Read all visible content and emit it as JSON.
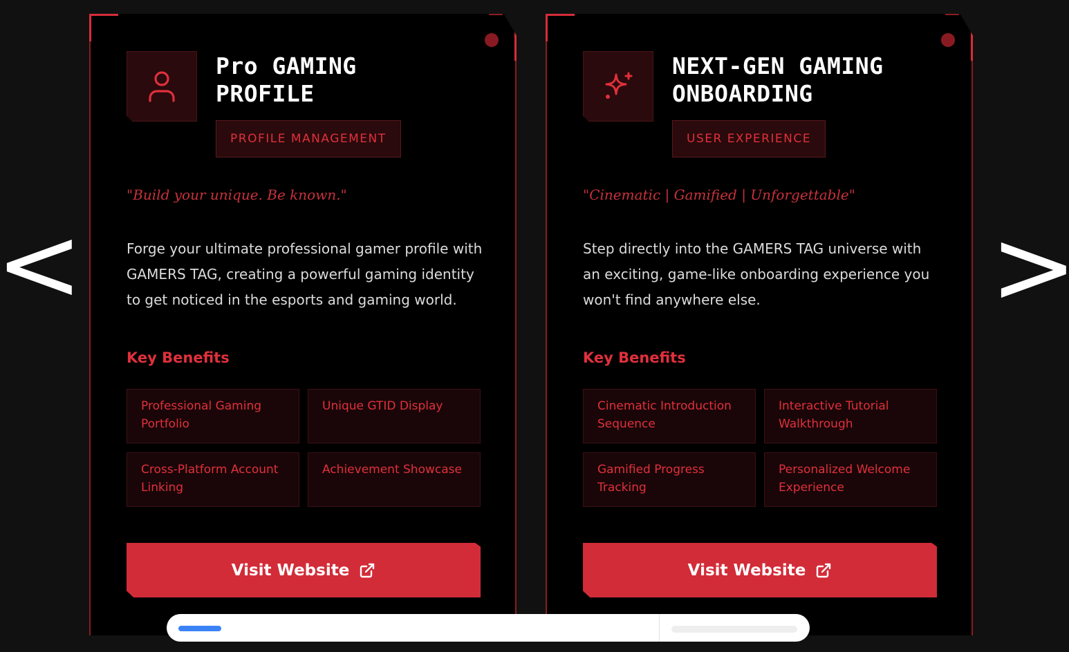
{
  "nav": {
    "prev_label": "<",
    "next_label": ">"
  },
  "cards": [
    {
      "icon": "user-icon",
      "title_line1": "Pro GAMING",
      "title_line2": "PROFILE",
      "tag": "PROFILE MANAGEMENT",
      "quote": "\"Build your unique. Be known.\"",
      "description": "Forge your ultimate professional gamer profile with GAMERS TAG, creating a powerful gaming identity to get noticed in the esports and gaming world.",
      "key_benefits_label": "Key Benefits",
      "benefits": [
        "Professional Gaming Portfolio",
        "Unique GTID Display",
        "Cross-Platform Account Linking",
        "Achievement Showcase"
      ],
      "button_label": "Visit Website",
      "button_icon": "external-link-icon"
    },
    {
      "icon": "sparkles-icon",
      "title_line1": "NEXT-GEN GAMING",
      "title_line2": "ONBOARDING",
      "tag": "USER EXPERIENCE",
      "quote": "\"Cinematic | Gamified | Unforgettable\"",
      "description": "Step directly into the GAMERS TAG universe with an exciting, game-like onboarding experience you won't find anywhere else.",
      "key_benefits_label": "Key Benefits",
      "benefits": [
        "Cinematic Introduction Sequence",
        "Interactive Tutorial Walkthrough",
        "Gamified Progress Tracking",
        "Personalized Welcome Experience"
      ],
      "button_label": "Visit Website",
      "button_icon": "external-link-icon"
    }
  ],
  "colors": {
    "background": "#111111",
    "card": "#000000",
    "accent": "#d22c38",
    "accent_text": "#e0303c",
    "border": "#8a1c22"
  }
}
